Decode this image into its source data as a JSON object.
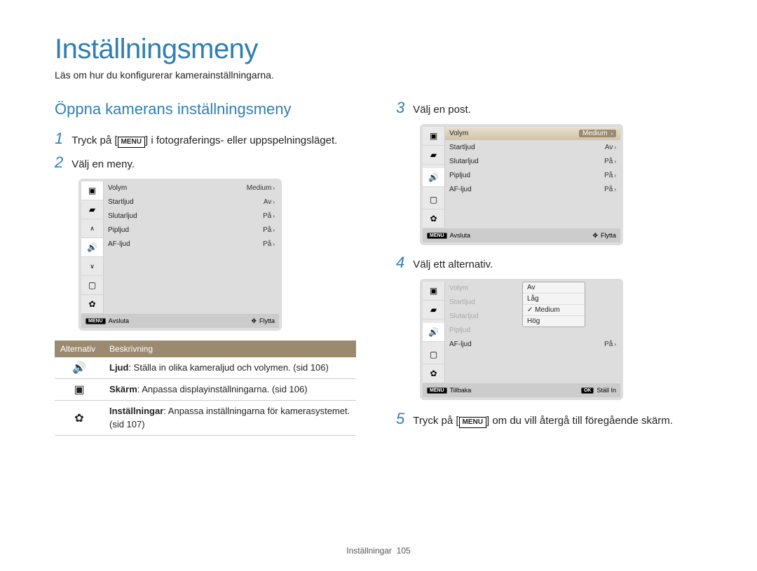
{
  "title": "Inställningsmeny",
  "subtitle": "Läs om hur du konfigurerar kamerainställningarna.",
  "sectionHeading": "Öppna kamerans inställningsmeny",
  "menuLabel": "MENU",
  "steps": {
    "s1a": "Tryck på [",
    "s1b": "] i fotograferings- eller uppspelningsläget.",
    "s2": "Välj en meny.",
    "s3": "Välj en post.",
    "s4": "Välj ett alternativ.",
    "s5a": "Tryck på [",
    "s5b": "] om du vill återgå till föregående skärm."
  },
  "menuRows": [
    {
      "label": "Volym",
      "value": "Medium"
    },
    {
      "label": "Startljud",
      "value": "Av"
    },
    {
      "label": "Slutarljud",
      "value": "På"
    },
    {
      "label": "Pipljud",
      "value": "På"
    },
    {
      "label": "AF-ljud",
      "value": "På"
    }
  ],
  "footer1": {
    "leftIcon": "MENU",
    "left": "Avsluta",
    "right": "Flytta"
  },
  "footer2": {
    "leftIcon": "MENU",
    "left": "Tillbaka",
    "rightIcon": "OK",
    "right": "Ställ In"
  },
  "optionsHeader": {
    "c1": "Alternativ",
    "c2": "Beskrivning"
  },
  "options": [
    {
      "icon": "speaker",
      "bold": "Ljud",
      "text": ": Ställa in olika kameraljud och volymen. (sid 106)"
    },
    {
      "icon": "display",
      "bold": "Skärm",
      "text": ": Anpassa displayinställningarna. (sid 106)"
    },
    {
      "icon": "gear",
      "bold": "Inställningar",
      "text": ": Anpassa inställningarna för kamerasystemet. (sid 107)"
    }
  ],
  "dropdown": [
    "Av",
    "Låg",
    "Medium",
    "Hög"
  ],
  "screen3Residual": {
    "label": "AF-ljud",
    "value": "På"
  },
  "pageFooter": {
    "label": "Inställningar",
    "num": "105"
  }
}
